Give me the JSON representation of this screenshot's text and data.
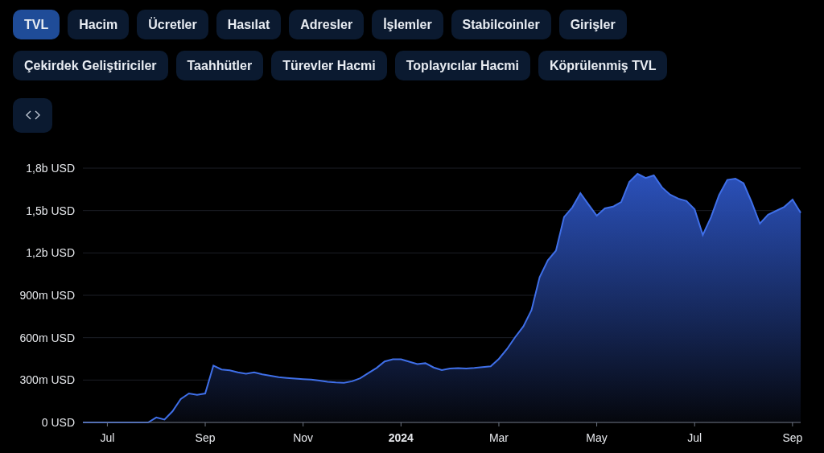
{
  "tabs": [
    {
      "label": "TVL",
      "selected": true
    },
    {
      "label": "Hacim",
      "selected": false
    },
    {
      "label": "Ücretler",
      "selected": false
    },
    {
      "label": "Hasılat",
      "selected": false
    },
    {
      "label": "Adresler",
      "selected": false
    },
    {
      "label": "İşlemler",
      "selected": false
    },
    {
      "label": "Stabilcoinler",
      "selected": false
    },
    {
      "label": "Girişler",
      "selected": false
    },
    {
      "label": "Çekirdek Geliştiriciler",
      "selected": false
    },
    {
      "label": "Taahhütler",
      "selected": false
    },
    {
      "label": "Türevler Hacmi",
      "selected": false
    },
    {
      "label": "Toplayıcılar Hacmi",
      "selected": false
    },
    {
      "label": "Köprülenmiş TVL",
      "selected": false
    }
  ],
  "chart_data": {
    "type": "area",
    "grid": true,
    "categories": [
      null,
      null,
      null,
      "Jul",
      null,
      null,
      null,
      null,
      null,
      null,
      null,
      null,
      null,
      null,
      null,
      "Sep",
      null,
      null,
      null,
      null,
      null,
      null,
      null,
      null,
      null,
      null,
      null,
      "Nov",
      null,
      null,
      null,
      null,
      null,
      null,
      null,
      null,
      null,
      null,
      null,
      "2024",
      null,
      null,
      null,
      null,
      null,
      null,
      null,
      null,
      null,
      null,
      null,
      "Mar",
      null,
      null,
      null,
      null,
      null,
      null,
      null,
      null,
      null,
      null,
      null,
      "May",
      null,
      null,
      null,
      null,
      null,
      null,
      null,
      null,
      null,
      null,
      null,
      "Jul",
      null,
      null,
      null,
      null,
      null,
      null,
      null,
      null,
      null,
      null,
      null,
      "Sep",
      null
    ],
    "series": [
      {
        "color": "#3f6fe8",
        "values": [
          0,
          0,
          0,
          0,
          0,
          0,
          0,
          0,
          0,
          35000000,
          20000000,
          80000000,
          165000000,
          205000000,
          195000000,
          205000000,
          402000000,
          375000000,
          369000000,
          355000000,
          345000000,
          355000000,
          340000000,
          330000000,
          320000000,
          315000000,
          310000000,
          306000000,
          303000000,
          297000000,
          288000000,
          283000000,
          280000000,
          291000000,
          313000000,
          350000000,
          385000000,
          432000000,
          447000000,
          447000000,
          430000000,
          413000000,
          419000000,
          389000000,
          370000000,
          382000000,
          385000000,
          382000000,
          386000000,
          392000000,
          397000000,
          450000000,
          520000000,
          604000000,
          680000000,
          795000000,
          1028000000,
          1148000000,
          1216000000,
          1455000000,
          1522000000,
          1623000000,
          1542000000,
          1464000000,
          1515000000,
          1528000000,
          1560000000,
          1703000000,
          1760000000,
          1731000000,
          1749000000,
          1664000000,
          1612000000,
          1584000000,
          1567000000,
          1509000000,
          1327000000,
          1452000000,
          1610000000,
          1717000000,
          1726000000,
          1693000000,
          1558000000,
          1407000000,
          1470000000,
          1498000000,
          1526000000,
          1578000000,
          1484000000
        ]
      }
    ],
    "yticks": [
      {
        "value": 0,
        "label": "0 USD"
      },
      {
        "value": 300000000,
        "label": "300m USD"
      },
      {
        "value": 600000000,
        "label": "600m USD"
      },
      {
        "value": 900000000,
        "label": "900m USD"
      },
      {
        "value": 1200000000,
        "label": "1,2b USD"
      },
      {
        "value": 1500000000,
        "label": "1,5b USD"
      },
      {
        "value": 1800000000,
        "label": "1,8b USD"
      }
    ],
    "ylim": [
      0,
      1800000000
    ]
  }
}
